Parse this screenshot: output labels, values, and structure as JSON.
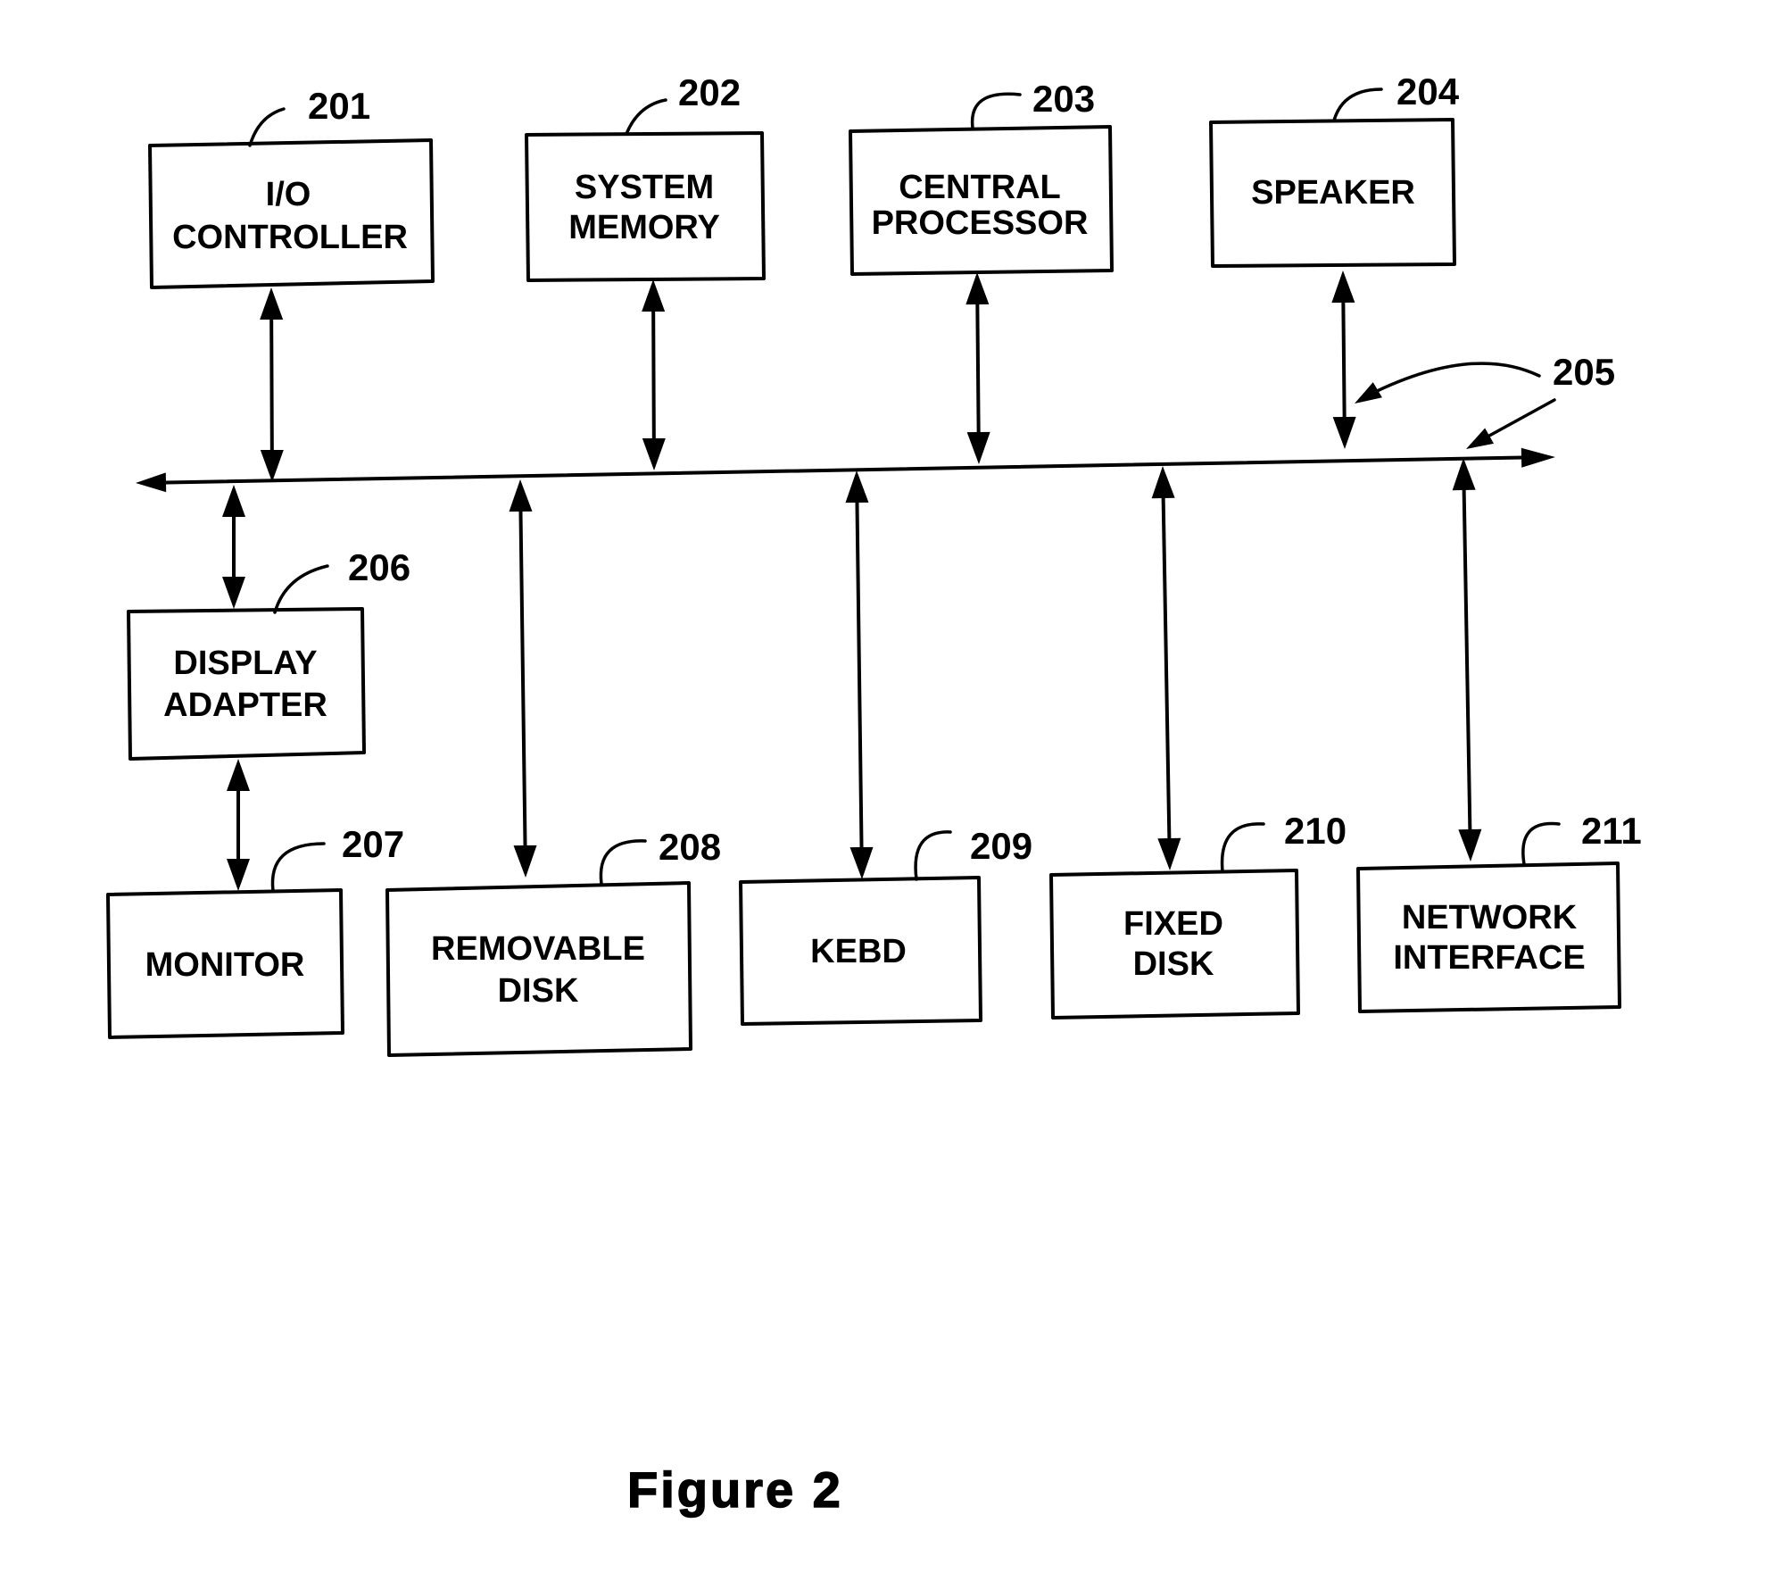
{
  "figure": {
    "caption": "Figure 2",
    "bus": {
      "ref": "205"
    },
    "components": [
      {
        "id": "io-controller",
        "ref": "201",
        "lines": [
          "I/O",
          "CONTROLLER"
        ]
      },
      {
        "id": "system-memory",
        "ref": "202",
        "lines": [
          "SYSTEM",
          "MEMORY"
        ]
      },
      {
        "id": "central-processor",
        "ref": "203",
        "lines": [
          "CENTRAL",
          "PROCESSOR"
        ]
      },
      {
        "id": "speaker",
        "ref": "204",
        "lines": [
          "SPEAKER"
        ]
      },
      {
        "id": "display-adapter",
        "ref": "206",
        "lines": [
          "DISPLAY",
          "ADAPTER"
        ]
      },
      {
        "id": "monitor",
        "ref": "207",
        "lines": [
          "MONITOR"
        ]
      },
      {
        "id": "removable-disk",
        "ref": "208",
        "lines": [
          "REMOVABLE",
          "DISK"
        ]
      },
      {
        "id": "keyboard",
        "ref": "209",
        "lines": [
          "KEBD"
        ]
      },
      {
        "id": "fixed-disk",
        "ref": "210",
        "lines": [
          "FIXED",
          "DISK"
        ]
      },
      {
        "id": "network-interface",
        "ref": "211",
        "lines": [
          "NETWORK",
          "INTERFACE"
        ]
      }
    ],
    "connections": [
      {
        "from": "io-controller",
        "to": "bus",
        "direction": "bidirectional"
      },
      {
        "from": "system-memory",
        "to": "bus",
        "direction": "bidirectional"
      },
      {
        "from": "central-processor",
        "to": "bus",
        "direction": "bidirectional"
      },
      {
        "from": "speaker",
        "to": "bus",
        "direction": "bidirectional"
      },
      {
        "from": "bus",
        "to": "display-adapter",
        "direction": "bidirectional"
      },
      {
        "from": "display-adapter",
        "to": "monitor",
        "direction": "bidirectional"
      },
      {
        "from": "bus",
        "to": "removable-disk",
        "direction": "bidirectional"
      },
      {
        "from": "bus",
        "to": "keyboard",
        "direction": "bidirectional"
      },
      {
        "from": "bus",
        "to": "fixed-disk",
        "direction": "bidirectional"
      },
      {
        "from": "bus",
        "to": "network-interface",
        "direction": "bidirectional"
      }
    ]
  }
}
